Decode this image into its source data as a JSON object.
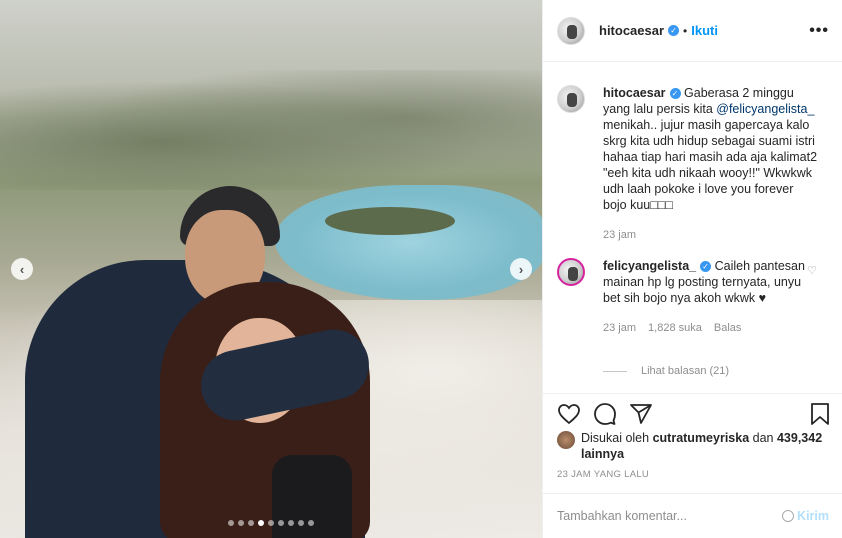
{
  "post": {
    "author": "hitocaesar",
    "follow_separator": "•",
    "follow_label": "Ikuti",
    "more_icon": "more-horizontal-icon"
  },
  "carousel": {
    "dot_count": 9,
    "active_index": 3
  },
  "caption": {
    "username": "hitocaesar",
    "text_before": "Gaberasa 2 minggu yang lalu persis kita ",
    "mention": "@felicyangelista_",
    "text_after": " menikah.. jujur masih gapercaya kalo skrg kita udh hidup sebagai suami istri hahaa tiap hari masih ada aja kalimat2 \"eeh kita udh nikaah wooy!!\" Wkwkwk udh laah pokoke i love you forever bojo kuu□□□",
    "time": "23 jam"
  },
  "top_comment": {
    "username": "felicyangelista_",
    "text": "Caileh pantesan mainan hp lg posting ternyata, unyu bet sih bojo nya akoh wkwk ♥",
    "time": "23 jam",
    "likes": "1,828 suka",
    "reply_label": "Balas",
    "view_replies": "Lihat balasan (21)"
  },
  "likes": {
    "prefix": "Disukai oleh ",
    "user": "cutratumeyriska",
    "middle": " dan ",
    "count": "439,342 lainnya"
  },
  "timestamp": "23 JAM YANG LALU",
  "add_comment": {
    "placeholder": "Tambahkan komentar...",
    "post_label": "Kirim"
  },
  "colors": {
    "link_blue": "#0095f6",
    "verified": "#3897f0",
    "muted": "#8e8e8e"
  }
}
